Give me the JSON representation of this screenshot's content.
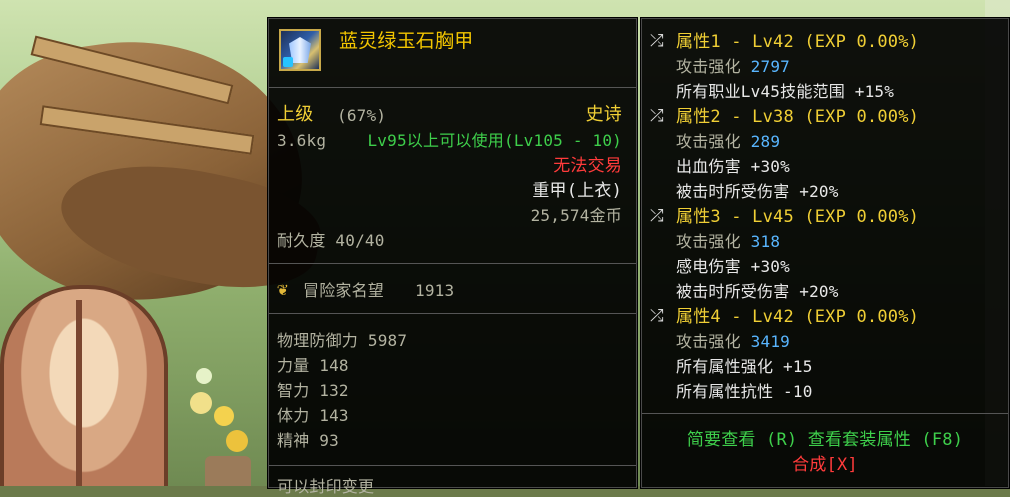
{
  "item": {
    "name": "蓝灵绿玉石胸甲",
    "grade": "上级",
    "grade_pct": "(67%)",
    "rarity": "史诗",
    "weight": "3.6kg",
    "level_req": "Lv95以上可以使用(Lv105 - 10)",
    "trade": "无法交易",
    "armor_type": "重甲(上衣)",
    "price": "25,574金币",
    "durability": "耐久度 40/40",
    "fame_label": "冒险家名望",
    "fame_value": "1913",
    "stats": [
      {
        "label": "物理防御力",
        "value": "5987"
      },
      {
        "label": "力量",
        "value": "148"
      },
      {
        "label": "智力",
        "value": "132"
      },
      {
        "label": "体力",
        "value": "143"
      },
      {
        "label": "精神",
        "value": "93"
      }
    ],
    "bottom_cut_text": "可以封印变更"
  },
  "attributes": [
    {
      "header": "属性1 - Lv42 (EXP 0.00%)",
      "enhance_label": "攻击强化",
      "enhance_value": "2797",
      "lines": [
        "所有职业Lv45技能范围 +15%"
      ]
    },
    {
      "header": "属性2 - Lv38 (EXP 0.00%)",
      "enhance_label": "攻击强化",
      "enhance_value": "289",
      "lines": [
        "出血伤害 +30%",
        "被击时所受伤害 +20%"
      ]
    },
    {
      "header": "属性3 - Lv45 (EXP 0.00%)",
      "enhance_label": "攻击强化",
      "enhance_value": "318",
      "lines": [
        "感电伤害 +30%",
        "被击时所受伤害 +20%"
      ]
    },
    {
      "header": "属性4 - Lv42 (EXP 0.00%)",
      "enhance_label": "攻击强化",
      "enhance_value": "3419",
      "lines": [
        "所有属性强化 +15",
        "所有属性抗性 -10"
      ]
    }
  ],
  "footer": {
    "summary": "简要查看 (R) 查看套装属性 (F8)",
    "combine": "合成[X]"
  },
  "icons": {
    "attribute_icon": "shuffle-icon",
    "fame_icon": "laurel-icon",
    "item_icon": "breastplate-icon"
  },
  "colors": {
    "rarity_epic": "#f0cf35",
    "requirement_green": "#3ecf4b",
    "untradeable_red": "#ff3b3b",
    "enhance_value_blue": "#59b6ff"
  }
}
